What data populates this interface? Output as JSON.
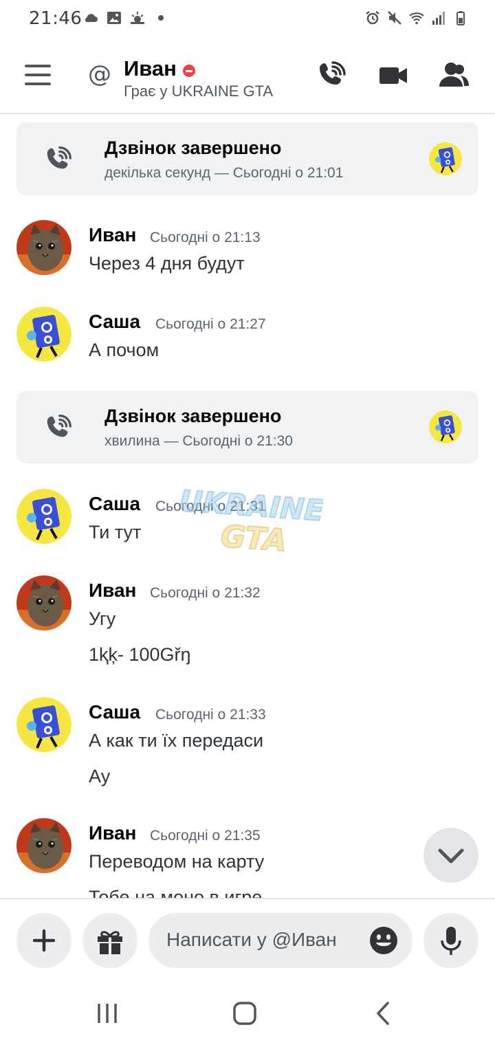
{
  "status_bar": {
    "time": "21:46",
    "left_icons": [
      "cloud-icon",
      "image-icon",
      "weather-icon",
      "dot-icon"
    ],
    "right_icons": [
      "alarm-icon",
      "mute-icon",
      "wifi-icon",
      "signal-icon",
      "battery-icon"
    ]
  },
  "header": {
    "name": "Иван",
    "status_text": "Грає у UKRAINE GTA",
    "status_color": "#ed4245",
    "buttons": [
      "voice-call-button",
      "video-call-button",
      "members-button"
    ]
  },
  "messages": [
    {
      "type": "call",
      "title": "Дзвінок завершено",
      "subtitle": "декілька секунд — Сьогодні о 21:01"
    },
    {
      "type": "message",
      "author": "Иван",
      "timestamp": "Сьогодні о 21:13",
      "lines": [
        "Через 4 дня будут"
      ]
    },
    {
      "type": "message",
      "author": "Саша",
      "timestamp": "Сьогодні о 21:27",
      "lines": [
        "А почом"
      ]
    },
    {
      "type": "call",
      "title": "Дзвінок завершено",
      "subtitle": "хвилина — Сьогодні о 21:30"
    },
    {
      "type": "message",
      "author": "Саша",
      "timestamp": "Сьогодні о 21:31",
      "lines": [
        "Ти тут"
      ]
    },
    {
      "type": "message",
      "author": "Иван",
      "timestamp": "Сьогодні о 21:32",
      "lines": [
        "Угу",
        "1ⱪķ- 100Gřŋ"
      ]
    },
    {
      "type": "message",
      "author": "Саша",
      "timestamp": "Сьогодні о 21:33",
      "lines": [
        "А как ти їх передаси",
        "Ау"
      ]
    },
    {
      "type": "message",
      "author": "Иван",
      "timestamp": "Сьогодні о 21:35",
      "lines": [
        "Переводом на карту",
        "Тобе на моно в игре"
      ]
    }
  ],
  "watermark": {
    "line1": "UKRAINE",
    "line2": "GTA"
  },
  "composer": {
    "placeholder": "Написати у @Иван"
  },
  "colors": {
    "card_bg": "#f0f2f4",
    "text_primary": "#060607",
    "text_muted": "#5c6370",
    "accent_blue": "#3a4fd8",
    "avatar_yellow": "#f5e642"
  }
}
